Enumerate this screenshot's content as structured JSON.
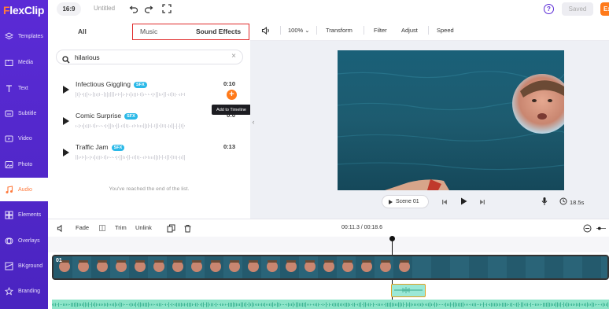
{
  "brand": {
    "logo_f": "F",
    "logo_rest": "lexClip"
  },
  "sidebar": {
    "items": [
      {
        "label": "Templates",
        "icon": "layers-icon"
      },
      {
        "label": "Media",
        "icon": "folder-icon"
      },
      {
        "label": "Text",
        "icon": "text-icon"
      },
      {
        "label": "Subtitle",
        "icon": "subtitle-icon"
      },
      {
        "label": "Video",
        "icon": "video-icon"
      },
      {
        "label": "Photo",
        "icon": "photo-icon"
      },
      {
        "label": "Audio",
        "icon": "music-icon",
        "active": true
      },
      {
        "label": "Elements",
        "icon": "elements-icon"
      },
      {
        "label": "Overlays",
        "icon": "overlays-icon"
      },
      {
        "label": "BKground",
        "icon": "background-icon"
      },
      {
        "label": "Branding",
        "icon": "branding-icon"
      }
    ]
  },
  "topbar": {
    "ratio": "16:9",
    "title": "Untitled",
    "saved": "Saved",
    "export": "Ex"
  },
  "audio_panel": {
    "tabs": {
      "all": "All",
      "music": "Music",
      "sfx": "Sound Effects"
    },
    "search": {
      "value": "hilarious",
      "clear": "×"
    },
    "items": [
      {
        "name": "Infectious Giggling",
        "badge": "SFX",
        "duration": "0:10"
      },
      {
        "name": "Comic Surprise",
        "badge": "SFX",
        "duration": "0:0"
      },
      {
        "name": "Traffic Jam",
        "badge": "SFX",
        "duration": "0:13"
      }
    ],
    "add_button": "+",
    "tooltip": "Add to Timeline",
    "end_text": "You've reached the end of the list."
  },
  "preview_toolbar": {
    "zoom": "100%",
    "transform": "Transform",
    "filter": "Filter",
    "adjust": "Adjust",
    "speed": "Speed"
  },
  "player": {
    "scene_label": "Scene",
    "scene_number": "01",
    "duration": "18.5s"
  },
  "timeline": {
    "fade": "Fade",
    "trim": "Trim",
    "unlink": "Unlink",
    "time": "00:11.3 / 00:18.6",
    "clip_label": "01"
  },
  "colors": {
    "sidebar": "#5b2bd6",
    "accent": "#ff7a1a",
    "highlight": "#e02a2a",
    "audio_track": "#8de5c9"
  }
}
